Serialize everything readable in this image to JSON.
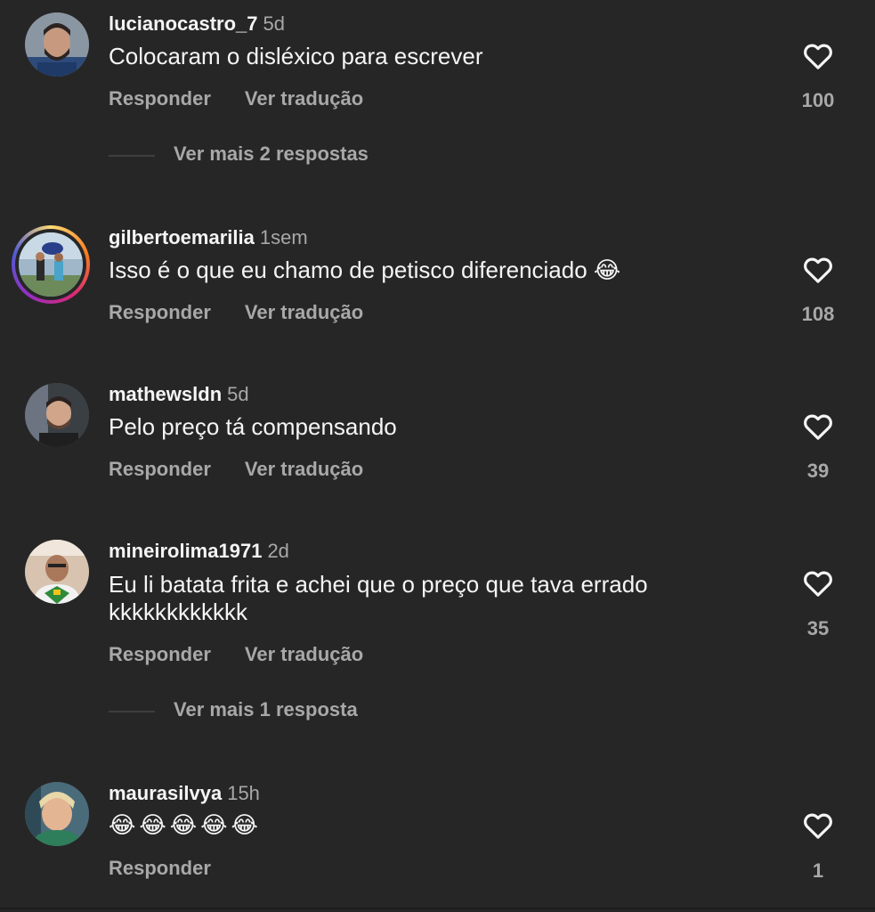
{
  "comments": [
    {
      "username": "lucianocastro_7",
      "time": "5d",
      "text": "Colocaram o disléxico para escrever",
      "reply_label": "Responder",
      "translate_label": "Ver tradução",
      "likes": "100",
      "more_replies": "Ver mais 2 respostas"
    },
    {
      "username": "gilbertoemarilia",
      "time": "1sem",
      "text": "Isso é o que eu chamo de petisco diferenciado 😂",
      "reply_label": "Responder",
      "translate_label": "Ver tradução",
      "likes": "108"
    },
    {
      "username": "mathewsldn",
      "time": "5d",
      "text": "Pelo preço tá compensando",
      "reply_label": "Responder",
      "translate_label": "Ver tradução",
      "likes": "39"
    },
    {
      "username": "mineirolima1971",
      "time": "2d",
      "text": "Eu li batata frita e achei que o preço que tava errado kkkkkkkkkkkk",
      "reply_label": "Responder",
      "translate_label": "Ver tradução",
      "likes": "35",
      "more_replies": "Ver mais 1 resposta"
    },
    {
      "username": "maurasilvya",
      "time": "15h",
      "text": "😂😂😂😂😂",
      "reply_label": "Responder",
      "likes": "1"
    }
  ],
  "icons": {
    "like": "heart-outline-icon"
  },
  "colors": {
    "background": "#262626",
    "primary_text": "#f5f5f5",
    "secondary_text": "#a8a8a8"
  }
}
